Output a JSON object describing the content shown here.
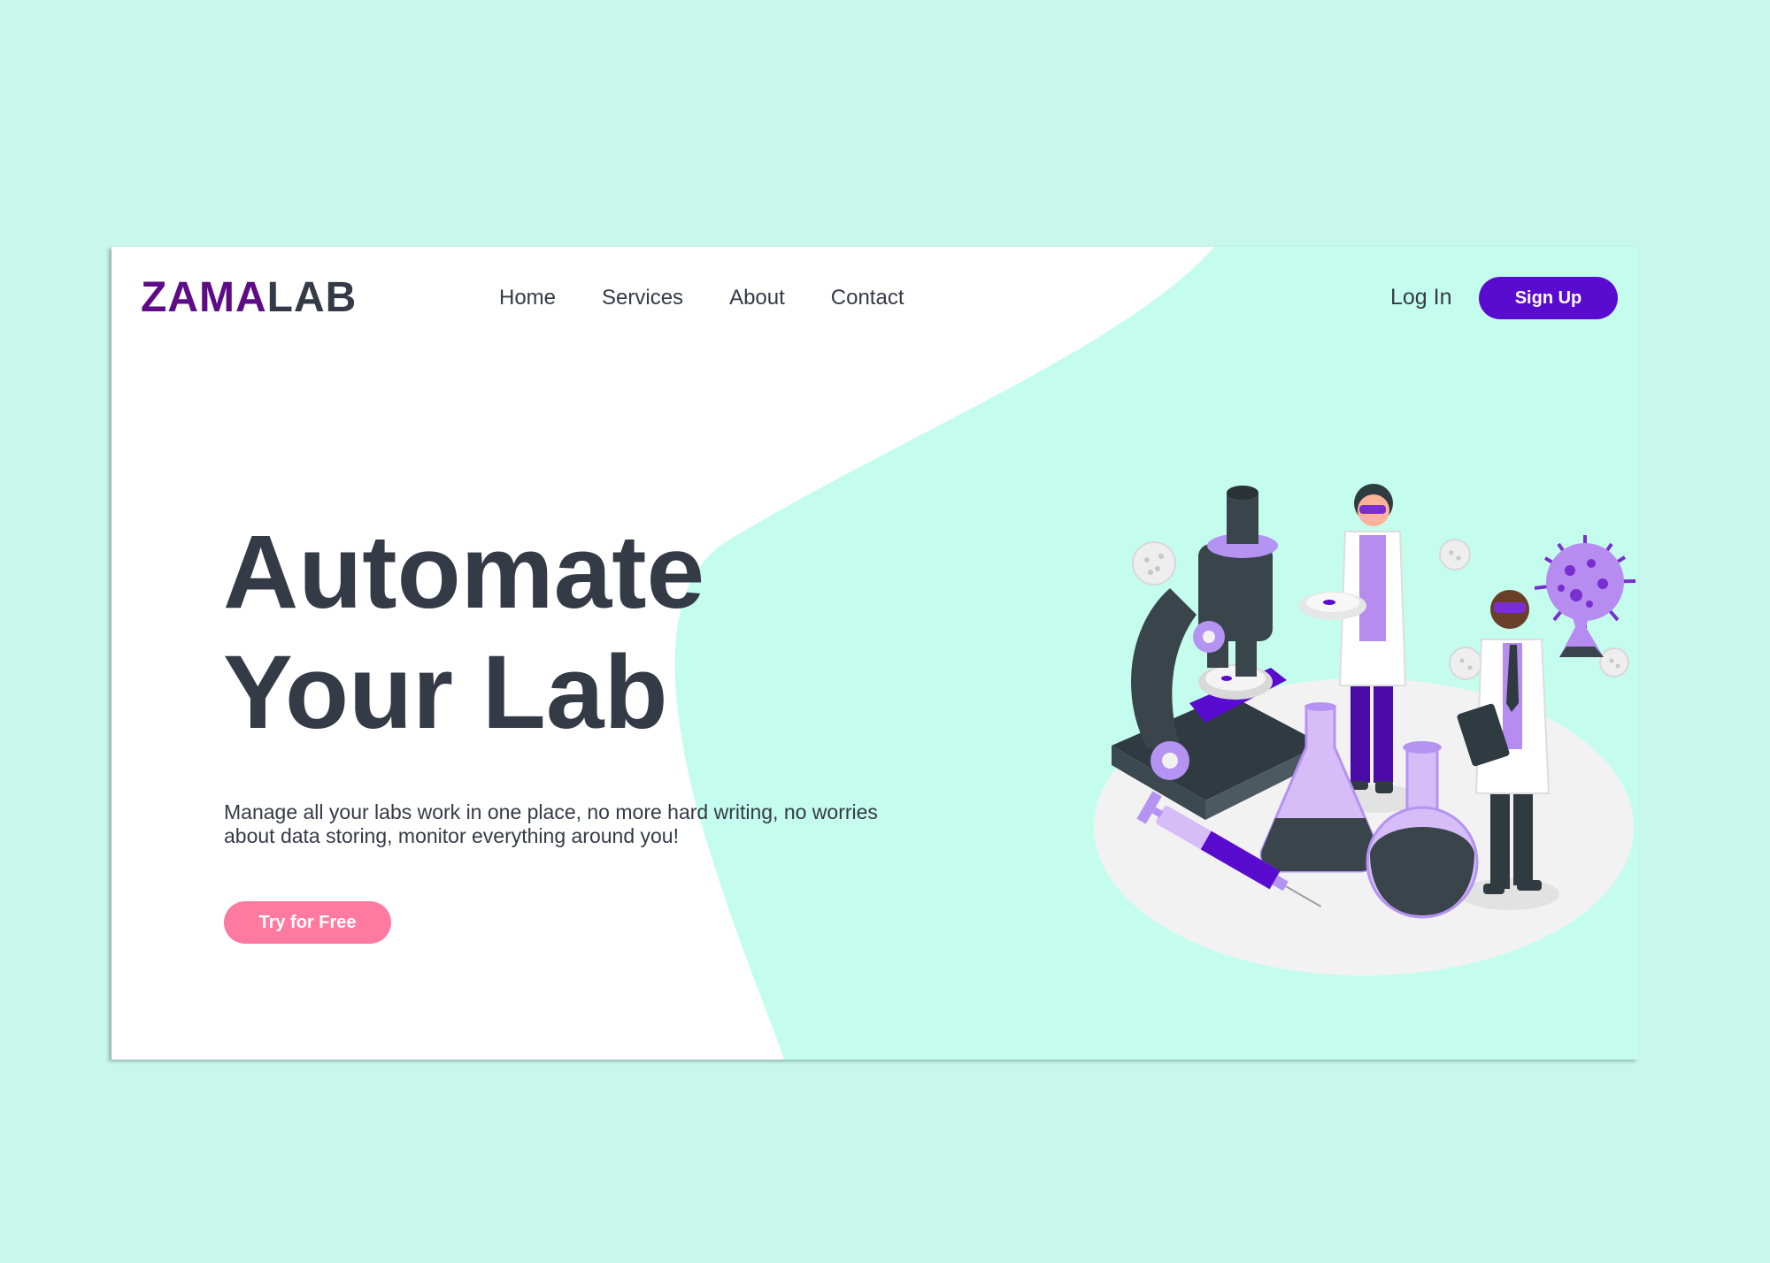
{
  "brand": {
    "logo_part1": "ZAMA",
    "logo_part2": "LAB"
  },
  "nav": {
    "items": [
      {
        "label": "Home"
      },
      {
        "label": "Services"
      },
      {
        "label": "About"
      },
      {
        "label": "Contact"
      }
    ]
  },
  "auth": {
    "login_label": "Log In",
    "signup_label": "Sign Up"
  },
  "hero": {
    "headline_line1": "Automate",
    "headline_line2": "Your Lab",
    "subtext": "Manage all your labs work in one place, no more hard writing, no worries about data storing, monitor everything around you!",
    "cta_label": "Try for Free"
  },
  "illustration": {
    "name": "laboratory-scientists-illustration"
  },
  "colors": {
    "page_background": "#c8f8ec",
    "card_background": "#ffffff",
    "blob": "#c4fdee",
    "brand_purple": "#5e0b86",
    "signup_button": "#5a0bd0",
    "cta_button": "#ff7aa0",
    "text_dark": "#343a46"
  }
}
